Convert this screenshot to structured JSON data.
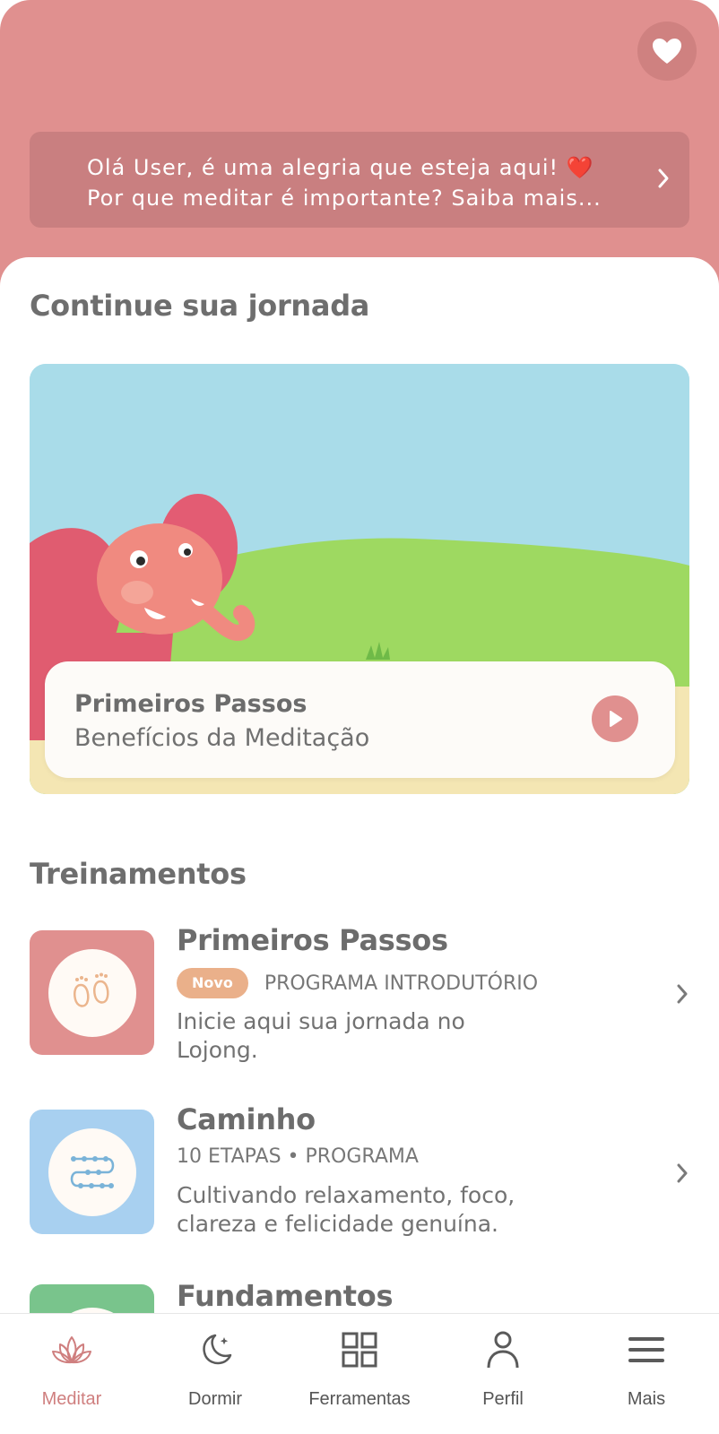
{
  "header": {
    "favorite_icon": "heart-icon",
    "greeting_line1": "Olá User, é uma alegria que esteja aqui! ❤️",
    "greeting_line2": "Por que meditar é importante? Saiba mais...",
    "background": "#e0908f"
  },
  "continue": {
    "title": "Continue sua jornada",
    "card_title": "Primeiros Passos",
    "card_subtitle": "Benefícios da Meditação",
    "play_icon": "play-icon"
  },
  "trainings": {
    "title": "Treinamentos",
    "items": [
      {
        "title": "Primeiros Passos",
        "badge": "Novo",
        "meta": "PROGRAMA INTRODUTÓRIO",
        "desc": "Inicie aqui sua jornada no Lojong.",
        "icon": "footprints-icon",
        "color": "#e0908f"
      },
      {
        "title": "Caminho",
        "meta": "10 ETAPAS • PROGRAMA",
        "desc": "Cultivando relaxamento, foco, clareza e felicidade genuína.",
        "icon": "path-icon",
        "color": "#a8d0f0"
      },
      {
        "title": "Fundamentos",
        "color": "#79c48c"
      }
    ]
  },
  "tabbar": {
    "accent": "#cf7f7f",
    "tabs": [
      {
        "label": "Meditar",
        "icon": "lotus-icon",
        "active": true
      },
      {
        "label": "Dormir",
        "icon": "moon-icon"
      },
      {
        "label": "Ferramentas",
        "icon": "grid-icon"
      },
      {
        "label": "Perfil",
        "icon": "person-icon"
      },
      {
        "label": "Mais",
        "icon": "menu-icon"
      }
    ]
  }
}
